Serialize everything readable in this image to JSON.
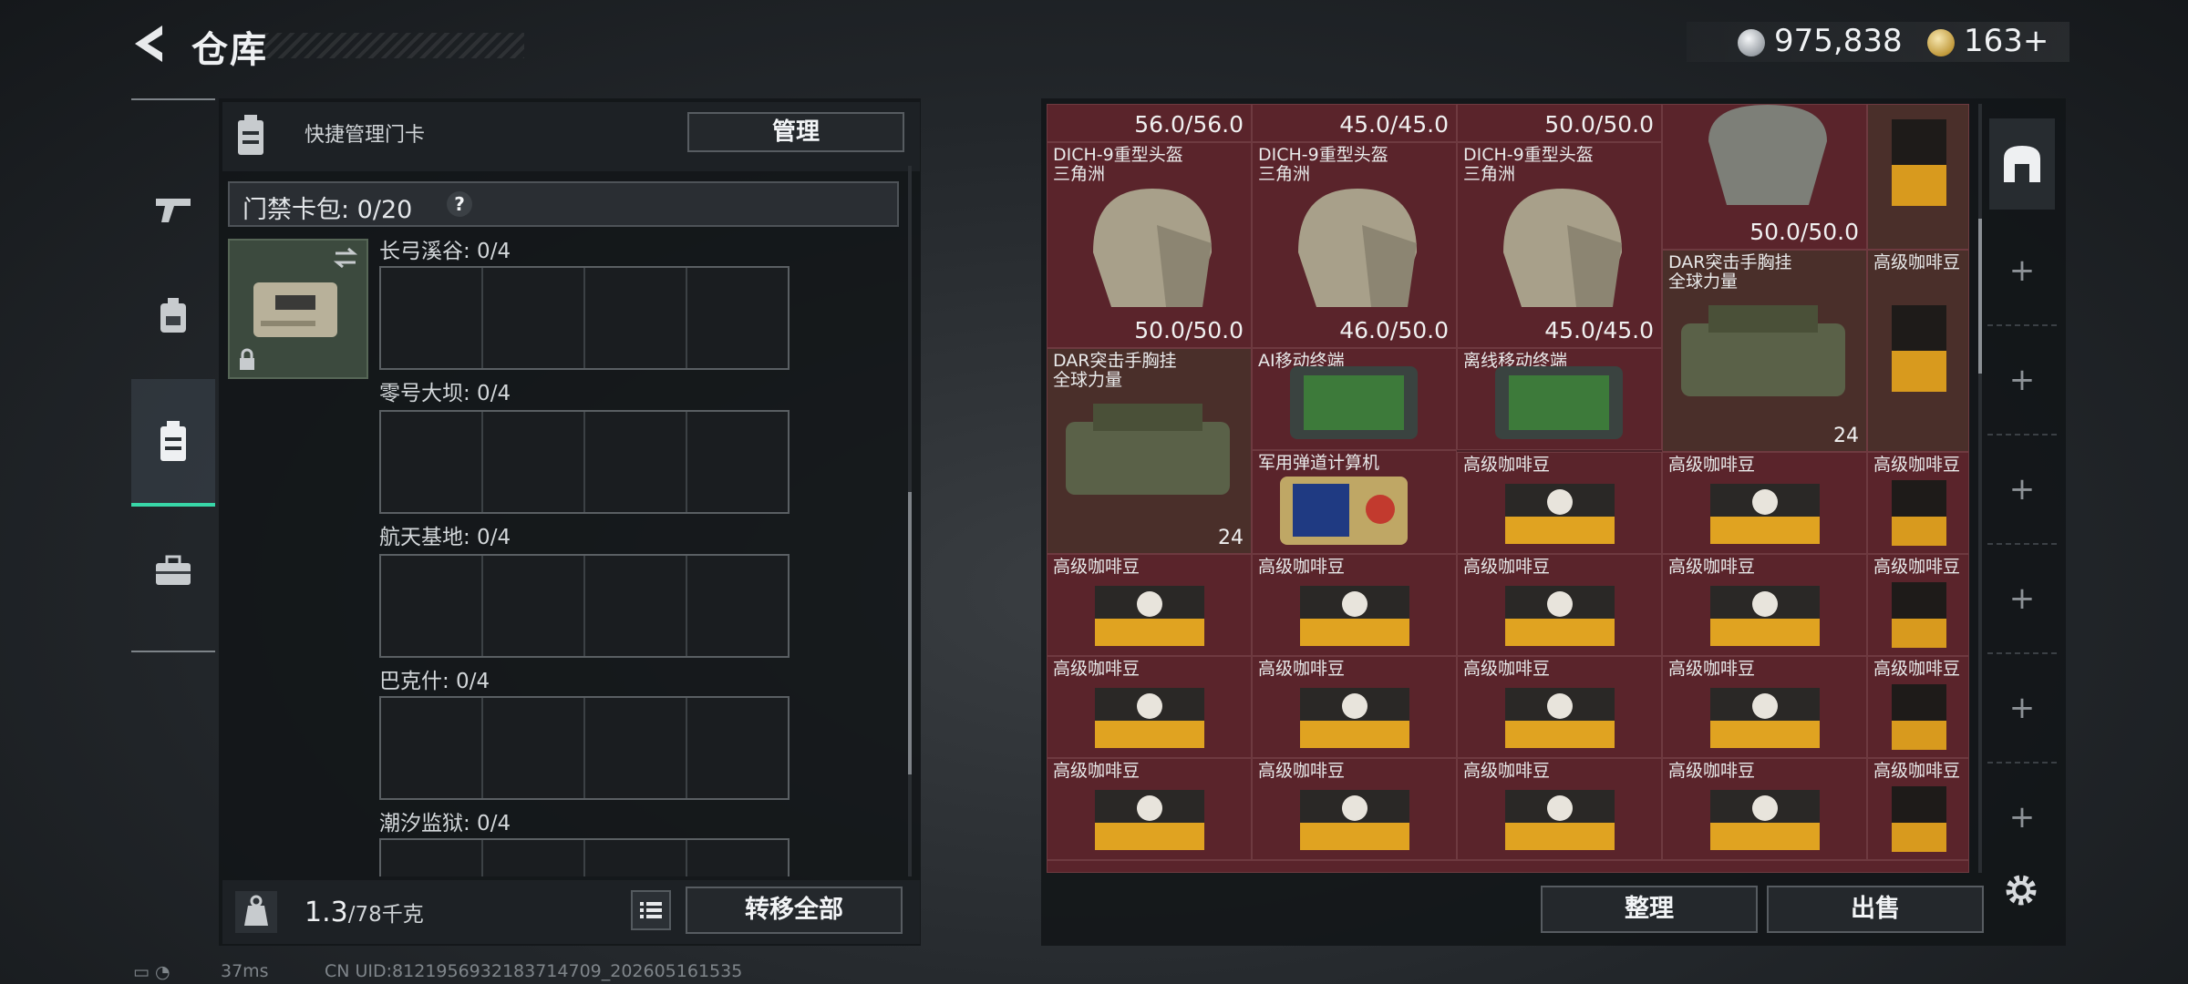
{
  "header": {
    "title": "仓库",
    "silver": "975,838",
    "gold": "163",
    "gold_plus": "+"
  },
  "left_panel": {
    "header_label": "快捷管理门卡",
    "manage_label": "管理",
    "wallet_label": "门禁卡包: 0/20",
    "help_label": "?",
    "maps": [
      {
        "label": "长弓溪谷: 0/4"
      },
      {
        "label": "零号大坝: 0/4"
      },
      {
        "label": "航天基地: 0/4"
      },
      {
        "label": "巴克什: 0/4"
      },
      {
        "label": "潮汐监狱: 0/4"
      }
    ],
    "weight_value": "1.3",
    "weight_max": "/78千克",
    "transfer_all_label": "转移全部"
  },
  "grid": {
    "top_partial": [
      "56.0/56.0",
      "45.0/45.0",
      "50.0/50.0"
    ],
    "items": [
      {
        "name": "DICH-9重型头盔\n三角洲",
        "value": "50.0/50.0"
      },
      {
        "name": "DICH-9重型头盔\n三角洲",
        "value": "46.0/50.0"
      },
      {
        "name": "DICH-9重型头盔\n三角洲",
        "value": "45.0/45.0"
      },
      {
        "name": "",
        "value": "50.0/50.0"
      },
      {
        "name": "DAR突击手胸挂\n全球力量",
        "value": "24"
      },
      {
        "name": "DAR突击手胸挂\n全球力量",
        "value": "24"
      },
      {
        "name": "AI移动终端",
        "value": ""
      },
      {
        "name": "离线移动终端",
        "value": ""
      },
      {
        "name": "军用弹道计算机",
        "value": ""
      },
      {
        "name": "高级咖啡豆",
        "value": ""
      }
    ]
  },
  "right_panel": {
    "organize_label": "整理",
    "sell_label": "出售"
  },
  "footer": {
    "ping": "37ms",
    "uid": "CN UID:8121956932183714709_202605161535"
  },
  "colors": {
    "accent": "#38d7a8",
    "grid_bg": "#5a242b"
  }
}
